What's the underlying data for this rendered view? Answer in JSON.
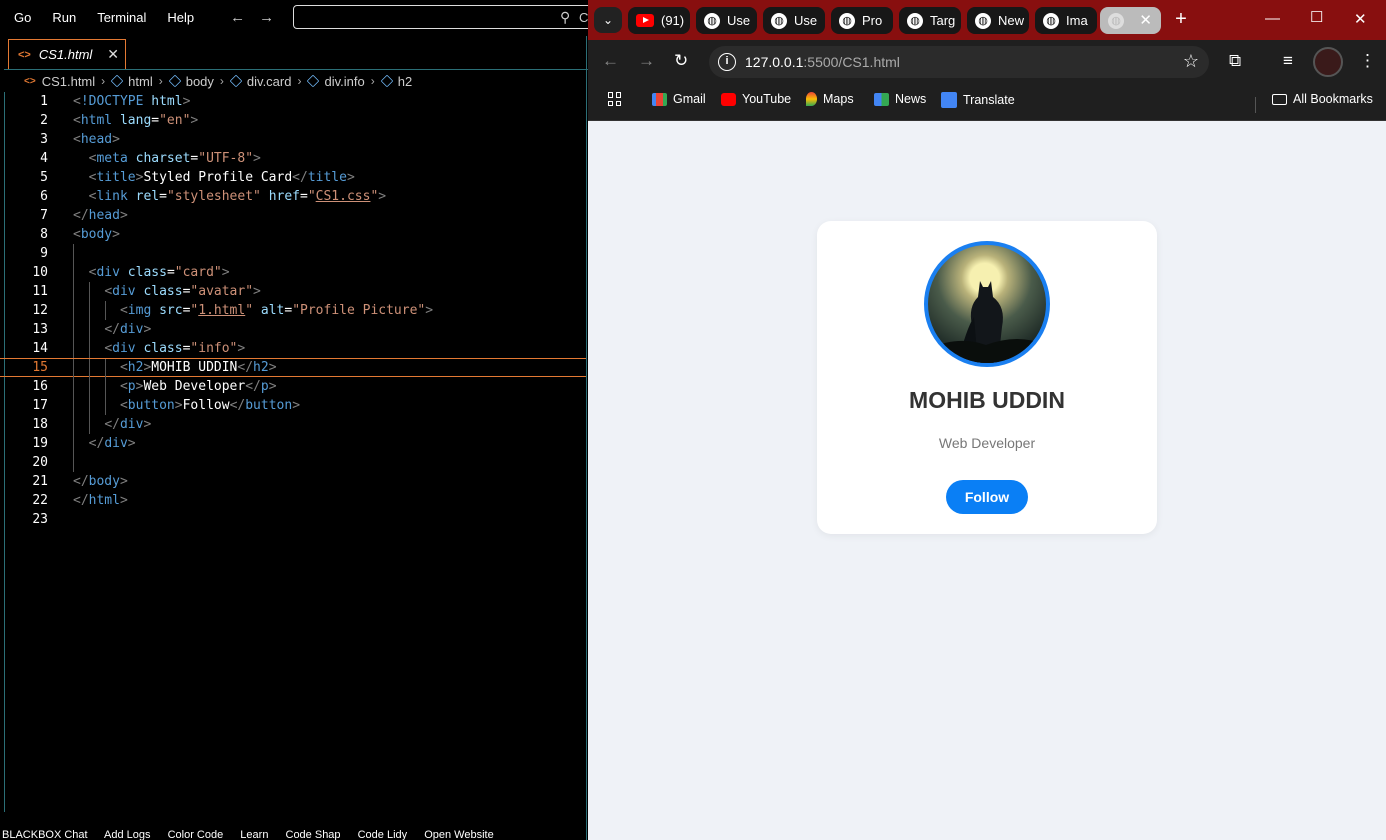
{
  "editor": {
    "menu": [
      "Go",
      "Run",
      "Terminal",
      "Help"
    ],
    "command_center_text": "C",
    "tab_label": "CS1.html",
    "breadcrumb": [
      "CS1.html",
      "html",
      "body",
      "div.card",
      "div.info",
      "h2"
    ],
    "active_line": 15,
    "lines": [
      {
        "n": "1",
        "t": [
          [
            "br",
            "<"
          ],
          [
            "dt",
            "!DOCTYPE"
          ],
          [
            "plain",
            " "
          ],
          [
            "attr",
            "html"
          ],
          [
            "br",
            ">"
          ]
        ]
      },
      {
        "n": "2",
        "t": [
          [
            "br",
            "<"
          ],
          [
            "tag",
            "html"
          ],
          [
            "plain",
            " "
          ],
          [
            "attr",
            "lang"
          ],
          [
            "plain",
            "="
          ],
          [
            "str",
            "\"en\""
          ],
          [
            "br",
            ">"
          ]
        ]
      },
      {
        "n": "3",
        "t": [
          [
            "br",
            "<"
          ],
          [
            "tag",
            "head"
          ],
          [
            "br",
            ">"
          ]
        ]
      },
      {
        "n": "4",
        "t": [
          [
            "plain",
            "  "
          ],
          [
            "br",
            "<"
          ],
          [
            "tag",
            "meta"
          ],
          [
            "plain",
            " "
          ],
          [
            "attr",
            "charset"
          ],
          [
            "plain",
            "="
          ],
          [
            "str",
            "\"UTF-8\""
          ],
          [
            "br",
            ">"
          ]
        ]
      },
      {
        "n": "5",
        "t": [
          [
            "plain",
            "  "
          ],
          [
            "br",
            "<"
          ],
          [
            "tag",
            "title"
          ],
          [
            "br",
            ">"
          ],
          [
            "plain",
            "Styled Profile Card"
          ],
          [
            "br",
            "</"
          ],
          [
            "tag",
            "title"
          ],
          [
            "br",
            ">"
          ]
        ]
      },
      {
        "n": "6",
        "t": [
          [
            "plain",
            "  "
          ],
          [
            "br",
            "<"
          ],
          [
            "tag",
            "link"
          ],
          [
            "plain",
            " "
          ],
          [
            "attr",
            "rel"
          ],
          [
            "plain",
            "="
          ],
          [
            "str",
            "\"stylesheet\""
          ],
          [
            "plain",
            " "
          ],
          [
            "attr",
            "href"
          ],
          [
            "plain",
            "="
          ],
          [
            "str",
            "\""
          ],
          [
            "stru",
            "CS1.css"
          ],
          [
            "str",
            "\""
          ],
          [
            "br",
            ">"
          ]
        ]
      },
      {
        "n": "7",
        "t": [
          [
            "br",
            "</"
          ],
          [
            "tag",
            "head"
          ],
          [
            "br",
            ">"
          ]
        ]
      },
      {
        "n": "8",
        "t": [
          [
            "br",
            "<"
          ],
          [
            "tag",
            "body"
          ],
          [
            "br",
            ">"
          ]
        ]
      },
      {
        "n": "9",
        "t": []
      },
      {
        "n": "10",
        "t": [
          [
            "plain",
            "  "
          ],
          [
            "br",
            "<"
          ],
          [
            "tag",
            "div"
          ],
          [
            "plain",
            " "
          ],
          [
            "attr",
            "class"
          ],
          [
            "plain",
            "="
          ],
          [
            "str",
            "\"card\""
          ],
          [
            "br",
            ">"
          ]
        ]
      },
      {
        "n": "11",
        "t": [
          [
            "plain",
            "    "
          ],
          [
            "br",
            "<"
          ],
          [
            "tag",
            "div"
          ],
          [
            "plain",
            " "
          ],
          [
            "attr",
            "class"
          ],
          [
            "plain",
            "="
          ],
          [
            "str",
            "\"avatar\""
          ],
          [
            "br",
            ">"
          ]
        ]
      },
      {
        "n": "12",
        "t": [
          [
            "plain",
            "      "
          ],
          [
            "br",
            "<"
          ],
          [
            "tag",
            "img"
          ],
          [
            "plain",
            " "
          ],
          [
            "attr",
            "src"
          ],
          [
            "plain",
            "="
          ],
          [
            "str",
            "\""
          ],
          [
            "stru",
            "1.html"
          ],
          [
            "str",
            "\""
          ],
          [
            "plain",
            " "
          ],
          [
            "attr",
            "alt"
          ],
          [
            "plain",
            "="
          ],
          [
            "str",
            "\"Profile Picture\""
          ],
          [
            "br",
            ">"
          ]
        ]
      },
      {
        "n": "13",
        "t": [
          [
            "plain",
            "    "
          ],
          [
            "br",
            "</"
          ],
          [
            "tag",
            "div"
          ],
          [
            "br",
            ">"
          ]
        ]
      },
      {
        "n": "14",
        "t": [
          [
            "plain",
            "    "
          ],
          [
            "br",
            "<"
          ],
          [
            "tag",
            "div"
          ],
          [
            "plain",
            " "
          ],
          [
            "attr",
            "class"
          ],
          [
            "plain",
            "="
          ],
          [
            "str",
            "\"info\""
          ],
          [
            "br",
            ">"
          ]
        ]
      },
      {
        "n": "15",
        "t": [
          [
            "plain",
            "      "
          ],
          [
            "br",
            "<"
          ],
          [
            "tag",
            "h2"
          ],
          [
            "br",
            ">"
          ],
          [
            "plain",
            "MOHIB UDDIN"
          ],
          [
            "br",
            "</"
          ],
          [
            "tag",
            "h2"
          ],
          [
            "br",
            ">"
          ]
        ]
      },
      {
        "n": "16",
        "t": [
          [
            "plain",
            "      "
          ],
          [
            "br",
            "<"
          ],
          [
            "tag",
            "p"
          ],
          [
            "br",
            ">"
          ],
          [
            "plain",
            "Web Developer"
          ],
          [
            "br",
            "</"
          ],
          [
            "tag",
            "p"
          ],
          [
            "br",
            ">"
          ]
        ]
      },
      {
        "n": "17",
        "t": [
          [
            "plain",
            "      "
          ],
          [
            "br",
            "<"
          ],
          [
            "tag",
            "button"
          ],
          [
            "br",
            ">"
          ],
          [
            "plain",
            "Follow"
          ],
          [
            "br",
            "</"
          ],
          [
            "tag",
            "button"
          ],
          [
            "br",
            ">"
          ]
        ]
      },
      {
        "n": "18",
        "t": [
          [
            "plain",
            "    "
          ],
          [
            "br",
            "</"
          ],
          [
            "tag",
            "div"
          ],
          [
            "br",
            ">"
          ]
        ]
      },
      {
        "n": "19",
        "t": [
          [
            "plain",
            "  "
          ],
          [
            "br",
            "</"
          ],
          [
            "tag",
            "div"
          ],
          [
            "br",
            ">"
          ]
        ]
      },
      {
        "n": "20",
        "t": []
      },
      {
        "n": "21",
        "t": [
          [
            "br",
            "</"
          ],
          [
            "tag",
            "body"
          ],
          [
            "br",
            ">"
          ]
        ]
      },
      {
        "n": "22",
        "t": [
          [
            "br",
            "</"
          ],
          [
            "tag",
            "html"
          ],
          [
            "br",
            ">"
          ]
        ]
      },
      {
        "n": "23",
        "t": []
      }
    ],
    "status_items": [
      "BLACKBOX Chat",
      "Add Logs",
      "Color Code",
      "Learn",
      "Code Shap",
      "Code Lidy",
      "Open Website"
    ]
  },
  "browser": {
    "tabs": [
      {
        "kind": "youtube",
        "label": "(91)"
      },
      {
        "kind": "globe",
        "label": "Use"
      },
      {
        "kind": "globe",
        "label": "Use"
      },
      {
        "kind": "globe",
        "label": "Pro"
      },
      {
        "kind": "globe",
        "label": "Targ"
      },
      {
        "kind": "globe",
        "label": "New"
      },
      {
        "kind": "globe",
        "label": "Ima"
      }
    ],
    "address_host": "127.0.0.1",
    "address_rest": ":5500/CS1.html",
    "bookmarks": [
      "Gmail",
      "YouTube",
      "Maps",
      "News",
      "Translate"
    ],
    "all_bookmarks": "All Bookmarks",
    "colors": {
      "titlebar": "#880f0f",
      "page_bg": "#eff2f7",
      "accent": "#0a7ff5"
    }
  },
  "card": {
    "name": "MOHIB UDDIN",
    "role": "Web Developer",
    "button": "Follow",
    "avatar_alt": "Profile Picture"
  }
}
